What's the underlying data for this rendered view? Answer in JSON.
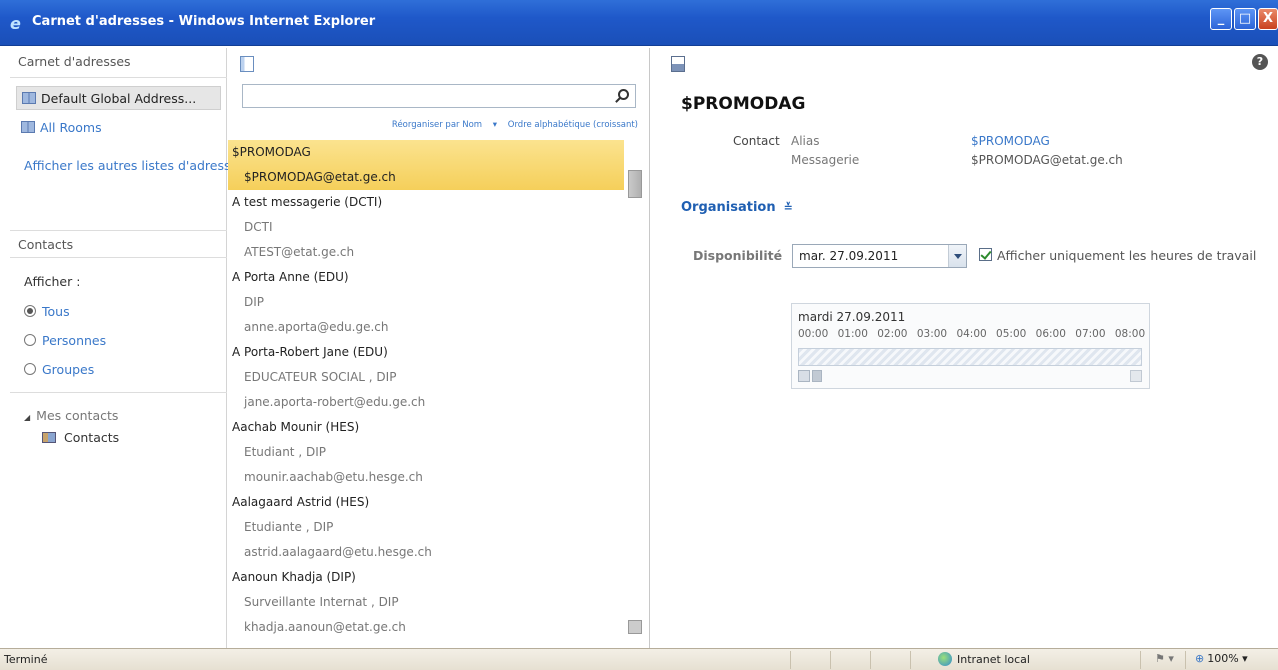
{
  "window": {
    "title": "Carnet d'adresses - Windows Internet Explorer",
    "controls": {
      "minimize": "_",
      "maximize": "□",
      "close": "X"
    }
  },
  "left_panel": {
    "title": "Carnet d'adresses",
    "address_books": [
      {
        "label": "Default Global Address...",
        "selected": true
      },
      {
        "label": "All Rooms",
        "selected": false
      }
    ],
    "other_lists_link": "Afficher les autres listes d'adresses",
    "contacts_title": "Contacts",
    "show_label": "Afficher :",
    "filters": [
      {
        "label": "Tous",
        "checked": true
      },
      {
        "label": "Personnes",
        "checked": false
      },
      {
        "label": "Groupes",
        "checked": false
      }
    ],
    "my_contacts": "Mes contacts",
    "contacts_folder": "Contacts"
  },
  "middle_panel": {
    "search": {
      "value": "",
      "placeholder": ""
    },
    "sort_by": "Réorganiser par Nom",
    "sort_arrow": "▾",
    "sort_order": "Ordre alphabétique (croissant)",
    "entries": [
      {
        "name": "$PROMODAG",
        "details": [
          "$PROMODAG@etat.ge.ch"
        ],
        "selected": true
      },
      {
        "name": "A test messagerie (DCTI)",
        "details": [
          "DCTI",
          "ATEST@etat.ge.ch"
        ]
      },
      {
        "name": "A Porta Anne (EDU)",
        "details": [
          "DIP",
          "anne.aporta@edu.ge.ch"
        ]
      },
      {
        "name": "A Porta-Robert Jane (EDU)",
        "details": [
          "EDUCATEUR SOCIAL , DIP",
          "jane.aporta-robert@edu.ge.ch"
        ]
      },
      {
        "name": "Aachab Mounir (HES)",
        "details": [
          "Etudiant , DIP",
          "mounir.aachab@etu.hesge.ch"
        ]
      },
      {
        "name": "Aalagaard Astrid (HES)",
        "details": [
          "Etudiante , DIP",
          "astrid.aalagaard@etu.hesge.ch"
        ]
      },
      {
        "name": "Aanoun Khadja (DIP)",
        "details": [
          "Surveillante Internat , DIP",
          "khadja.aanoun@etat.ge.ch"
        ]
      }
    ]
  },
  "right_panel": {
    "contact_name": "$PROMODAG",
    "contact_label": "Contact",
    "alias_label": "Alias",
    "alias_value": "$PROMODAG",
    "mail_label": "Messagerie",
    "mail_value": "$PROMODAG@etat.ge.ch",
    "organisation": "Organisation",
    "organisation_chevron": "≚",
    "availability_label": "Disponibilité",
    "availability_date": "mar. 27.09.2011",
    "work_hours_only": "Afficher uniquement les heures de travail",
    "work_hours_checked": true,
    "freebusy_date": "mardi 27.09.2011",
    "freebusy_hours": [
      "00:00",
      "01:00",
      "02:00",
      "03:00",
      "04:00",
      "05:00",
      "06:00",
      "07:00",
      "08:00"
    ],
    "help": "?"
  },
  "statusbar": {
    "status": "Terminé",
    "zone": "Intranet local",
    "zoom": "100%",
    "zoom_arrow": "▾",
    "security_arrow": "▾"
  }
}
